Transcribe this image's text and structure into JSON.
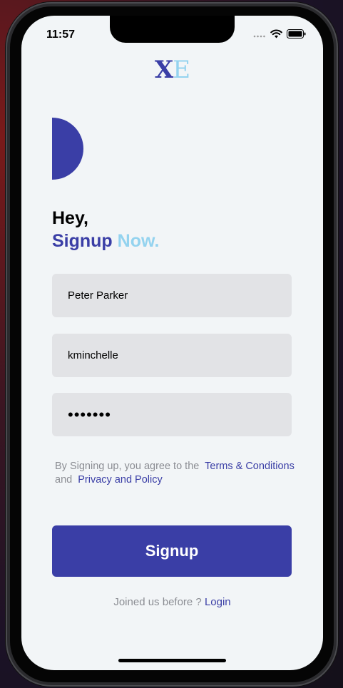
{
  "status_bar": {
    "time": "11:57",
    "icons": [
      "signal-icon",
      "wifi-icon",
      "battery-icon"
    ]
  },
  "logo": {
    "letter_1": "X",
    "letter_2": "E"
  },
  "heading": {
    "line_1": "Hey,",
    "line_2_part_1": "Signup",
    "line_2_part_2": "Now."
  },
  "form": {
    "name_value": "Peter Parker",
    "username_value": "kminchelle",
    "password_value": "•••••••"
  },
  "terms": {
    "prefix": "By Signing up, you agree to the",
    "terms_link": "Terms & Conditions",
    "conjunction": "and",
    "privacy_link": "Privacy and Policy"
  },
  "signup_button": {
    "label": "Signup"
  },
  "login": {
    "prompt": "Joined us before ?",
    "link": "Login"
  },
  "colors": {
    "primary": "#3a3ea6",
    "accent": "#94d3ef",
    "background": "#f2f5f7",
    "field": "#e2e3e6",
    "muted_text": "#8b8d93"
  }
}
